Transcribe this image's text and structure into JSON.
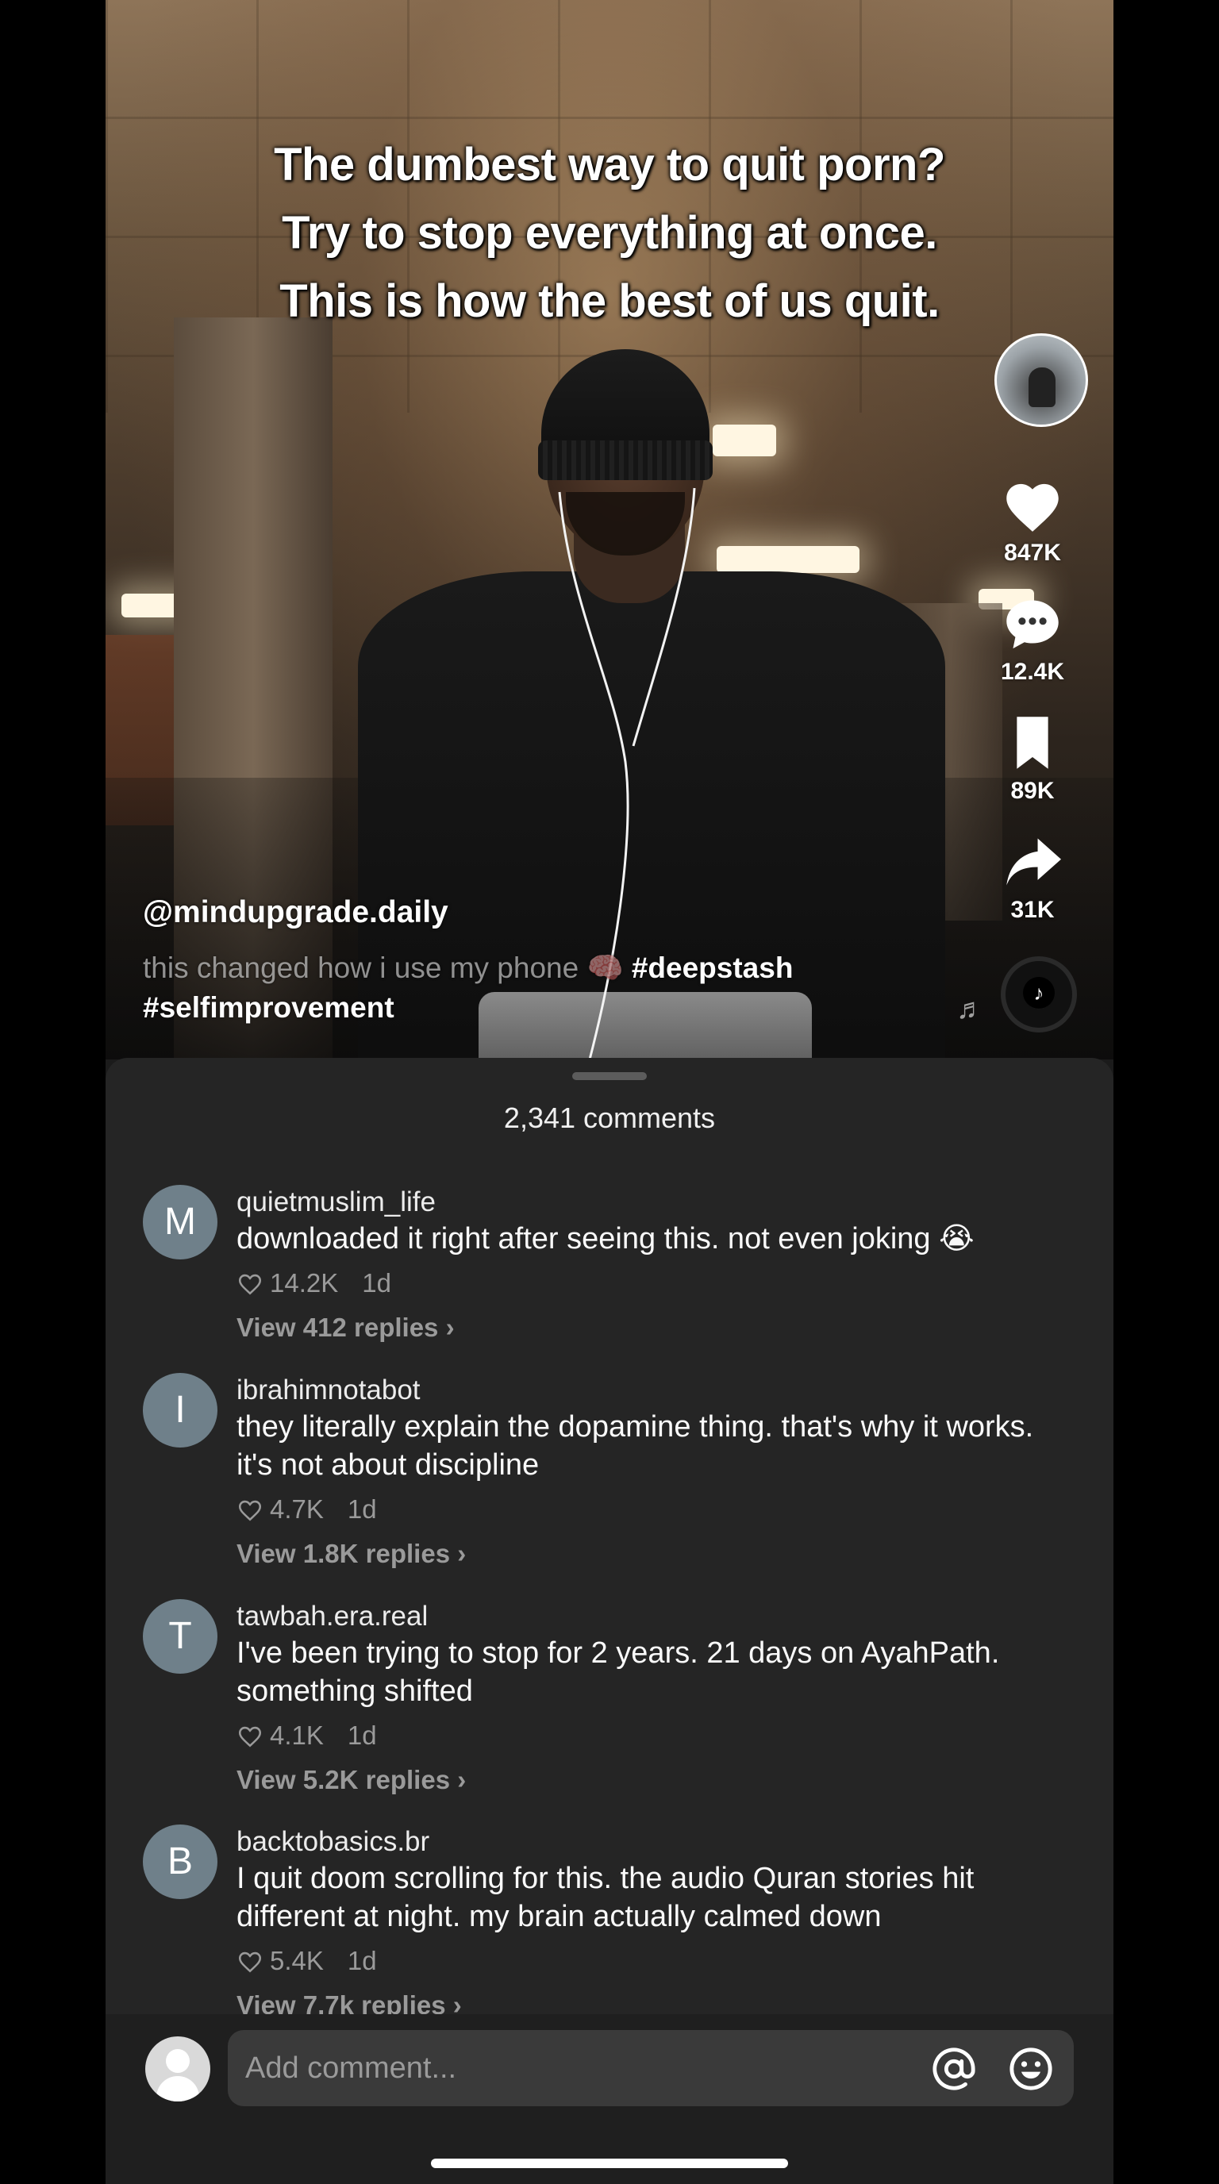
{
  "video": {
    "caption_lines": [
      "The dumbest way to quit porn?",
      "Try to stop everything at once.",
      "This is how the best of us quit."
    ],
    "username": "@mindupgrade.daily",
    "description": "this changed how i use my phone 🧠",
    "hashtags": [
      "#deepstash",
      "#selfimprovement"
    ]
  },
  "rail": {
    "likes": "847K",
    "comments": "12.4K",
    "saves": "89K",
    "shares": "31K",
    "music_logo": "♪"
  },
  "comments_sheet": {
    "count_label": "2,341 comments",
    "items": [
      {
        "initial": "M",
        "user": "quietmuslim_life",
        "text": "downloaded it right after seeing this. not even joking 😭",
        "likes": "14.2K",
        "time": "1d",
        "replies": "View 412 replies ›"
      },
      {
        "initial": "I",
        "user": "ibrahimnotabot",
        "text": "they literally explain the dopamine thing. that's why it works. it's not about discipline",
        "likes": "4.7K",
        "time": "1d",
        "replies": "View 1.8K replies ›"
      },
      {
        "initial": "T",
        "user": "tawbah.era.real",
        "text": "I've been trying to stop for 2 years. 21 days on AyahPath. something shifted",
        "likes": "4.1K",
        "time": "1d",
        "replies": "View 5.2K replies ›"
      },
      {
        "initial": "B",
        "user": "backtobasics.br",
        "text": "I quit doom scrolling for this. the audio Quran stories hit different at night. my brain actually calmed down",
        "likes": "5.4K",
        "time": "1d",
        "replies": "View 7.7k replies ›"
      }
    ]
  },
  "input": {
    "placeholder": "Add comment..."
  },
  "colors": {
    "sheet_bg": "#252525",
    "avatar_bg": "#6f808a",
    "muted_text": "#9a9a9a"
  }
}
